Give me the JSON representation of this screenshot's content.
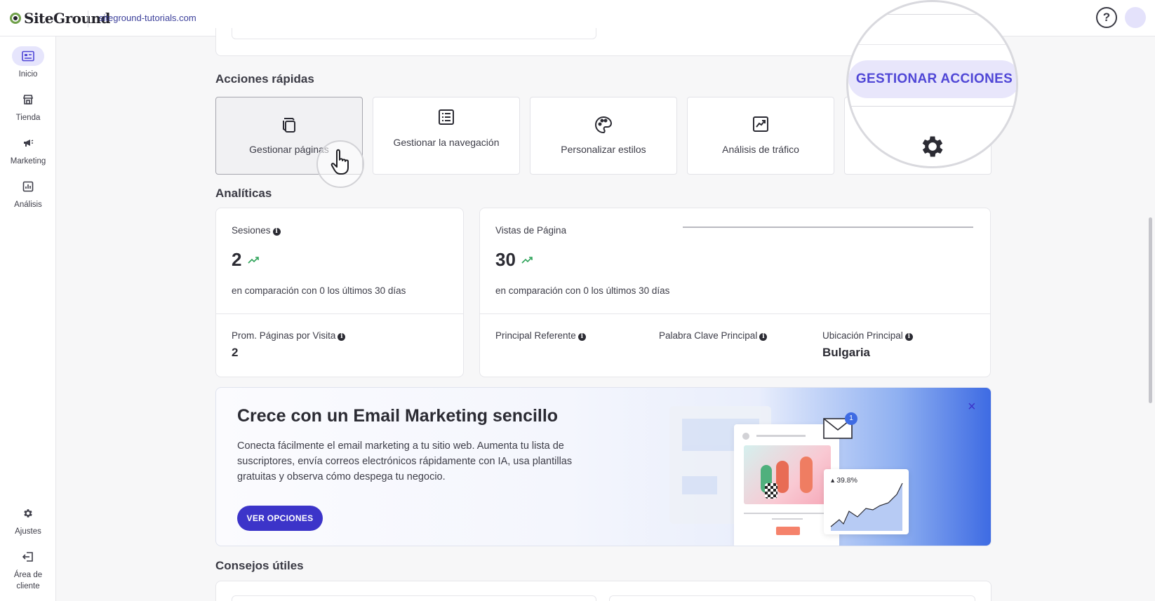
{
  "header": {
    "logo_text": "SiteGround",
    "site": "siteground-tutorials.com",
    "help_icon": "?"
  },
  "sidebar": {
    "items": [
      {
        "label": "Inicio",
        "icon": "dashboard-icon",
        "active": true
      },
      {
        "label": "Tienda",
        "icon": "store-icon"
      },
      {
        "label": "Marketing",
        "icon": "megaphone-icon"
      },
      {
        "label": "Análisis",
        "icon": "chart-icon"
      }
    ],
    "bottom": [
      {
        "label": "Ajustes",
        "icon": "gear-icon"
      },
      {
        "label": "Área de cliente",
        "icon": "exit-icon"
      }
    ]
  },
  "quick_actions": {
    "title": "Acciones rápidas",
    "items": [
      {
        "label": "Gestionar páginas",
        "icon": "pages-icon"
      },
      {
        "label": "Gestionar la navegación",
        "icon": "navigation-list-icon"
      },
      {
        "label": "Personalizar estilos",
        "icon": "palette-icon"
      },
      {
        "label": "Análisis de tráfico",
        "icon": "traffic-chart-icon"
      },
      {
        "label": "Gestionar acciones",
        "icon": "gear-icon"
      }
    ],
    "magnifier_label": "GESTIONAR ACCIONES"
  },
  "analytics": {
    "title": "Analíticas",
    "sessions": {
      "label": "Sesiones",
      "value": "2",
      "comparison": "en comparación con 0 los últimos 30 días"
    },
    "pageviews": {
      "label": "Vistas de Página",
      "value": "30",
      "comparison": "en comparación con 0 los últimos 30 días"
    },
    "avg_pages": {
      "label": "Prom. Páginas por Visita",
      "value": "2"
    },
    "top_referrer": {
      "label": "Principal Referente",
      "value": ""
    },
    "top_keyword": {
      "label": "Palabra Clave Principal",
      "value": ""
    },
    "top_location": {
      "label": "Ubicación Principal",
      "value": "Bulgaria"
    }
  },
  "promo": {
    "title": "Crece con un Email Marketing sencillo",
    "text": "Conecta fácilmente el email marketing a tu sitio web. Aumenta tu lista de suscriptores, envía correos electrónicos rápidamente con IA, usa plantillas gratuitas y observa cómo despega tu negocio.",
    "button": "VER OPCIONES",
    "close_icon": "×",
    "badge": "1",
    "stat": "39.8%"
  },
  "tips": {
    "title": "Consejos útiles"
  },
  "colors": {
    "accent": "#3c34c9",
    "active_nav": "#e6e5fc",
    "trend_green": "#2fa35a"
  }
}
